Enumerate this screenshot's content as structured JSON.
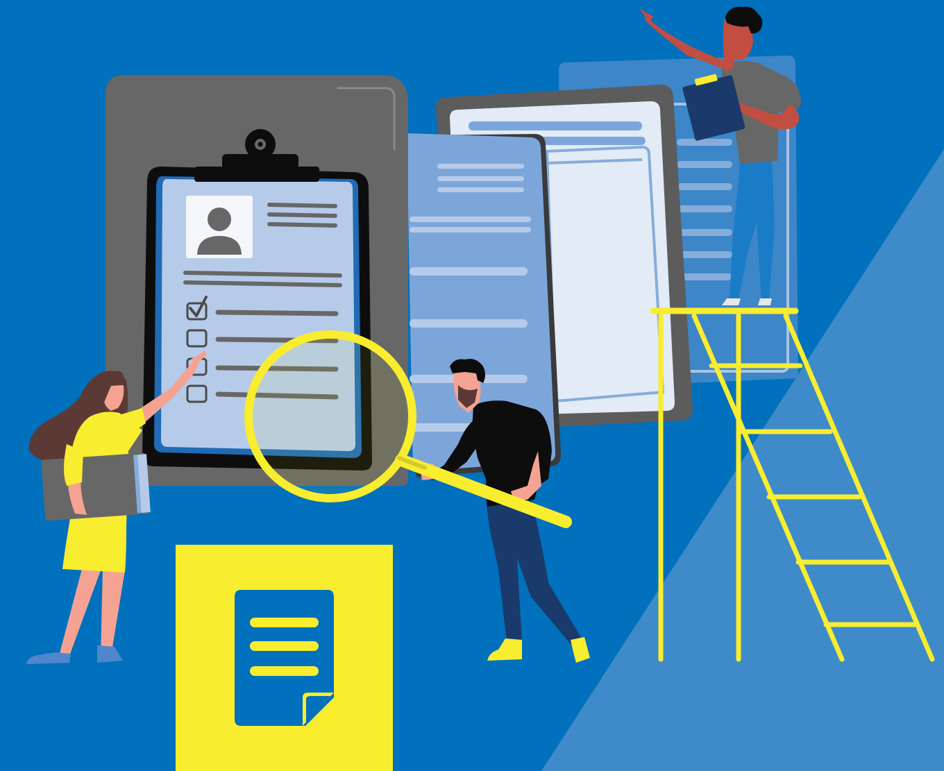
{
  "illustration": {
    "theme": "document review / checklist",
    "colors": {
      "background": "#0170bd",
      "background_light_triangle": "#3f8bc9",
      "accent_yellow": "#f8ed2f",
      "panel_gray": "#676767",
      "paper_light": "#b6cbe9",
      "paper_mid": "#7ca6da",
      "skin_tone_light": "#f4a393",
      "hair_brown": "#5b3a36"
    },
    "checklist": {
      "items": [
        {
          "checked": true
        },
        {
          "checked": false
        },
        {
          "checked": false
        },
        {
          "checked": false
        }
      ]
    },
    "icons": [
      "clipboard-icon",
      "profile-avatar-icon",
      "magnifying-glass-icon",
      "document-icon",
      "ladder-icon"
    ]
  }
}
